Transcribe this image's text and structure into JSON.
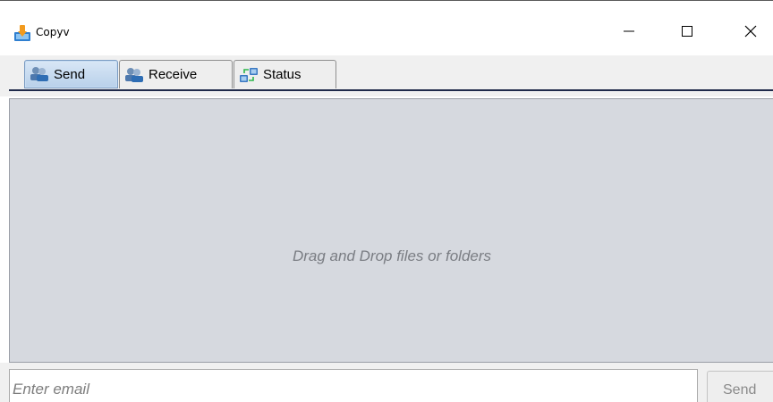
{
  "window": {
    "title": "Copyv",
    "icon": "copyv-app-icon",
    "controls": {
      "minimize": "minimize-icon",
      "maximize": "maximize-icon",
      "close": "close-icon"
    }
  },
  "tabs": [
    {
      "label": "Send",
      "icon": "users-icon",
      "active": true
    },
    {
      "label": "Receive",
      "icon": "users-icon",
      "active": false
    },
    {
      "label": "Status",
      "icon": "transfer-icon",
      "active": false
    }
  ],
  "drop_area": {
    "hint": "Drag and Drop files or folders"
  },
  "email": {
    "placeholder": "Enter email",
    "value": ""
  },
  "send_button": {
    "label": "Send",
    "enabled": false
  },
  "colors": {
    "active_tab": "#c6dbf1",
    "panel_background": "#d6d9df",
    "hint_text": "#7a7d83",
    "tab_underline": "#1f2a4a"
  }
}
